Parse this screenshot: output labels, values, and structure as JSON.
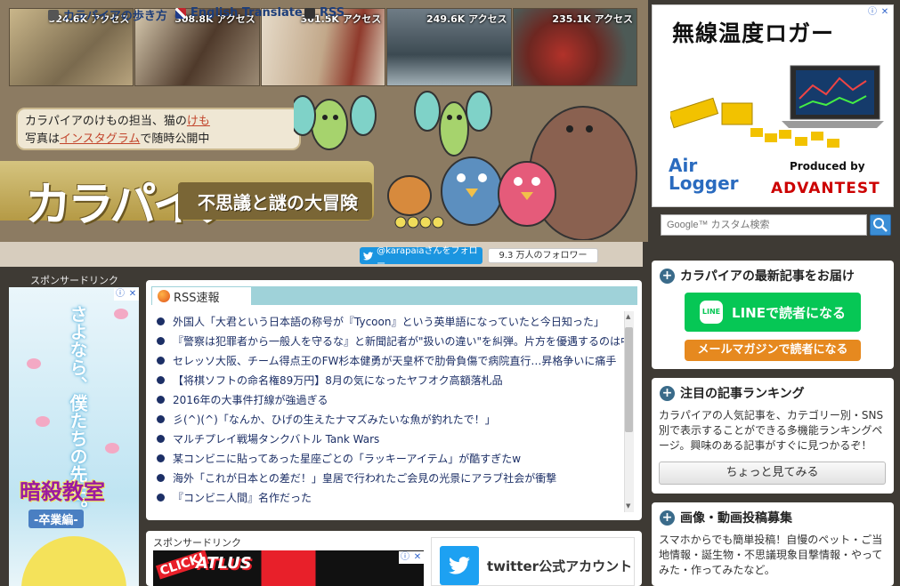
{
  "thumbnails": [
    {
      "views": "324.6K アクセス"
    },
    {
      "views": "308.8K アクセス"
    },
    {
      "views": "301.5K アクセス"
    },
    {
      "views": "249.6K アクセス"
    },
    {
      "views": "235.1K アクセス"
    }
  ],
  "cat_bubble": {
    "line1_prefix": "カラパイアのけもの担当、猫の",
    "line1_link": "けも",
    "line2_prefix": "写真は",
    "line2_link": "インスタグラム",
    "line2_suffix": "で随時公開中"
  },
  "logo": {
    "text": "カラパイア",
    "tagline": "不思議と謎の大冒険"
  },
  "nav": {
    "guide": "カラパイアの歩き方",
    "translate": "English Translate",
    "rss": "RSS",
    "twitter_follow": "@karapaiaさんをフォロー",
    "followers": "9.3 万人のフォロワー"
  },
  "ad_top": {
    "headline": "無線温度ロガー",
    "brand_left_line1": "Air",
    "brand_left_line2": "Logger",
    "produced_by": "Produced by",
    "brand_right": "ADVANTEST"
  },
  "search": {
    "placeholder": "Google™ カスタム検索"
  },
  "sponsor_left": {
    "title": "スポンサードリンク",
    "ad_vertical_text": "さよなら、僕たちの先生。",
    "ad_title": "暗殺教室",
    "ad_subtitle": "-卒業編-"
  },
  "rss": {
    "tab_label": "RSS速報",
    "items": [
      "外国人「大君という日本語の称号が『Tycoon』という英単語になっていたと今日知った」",
      "『警察は犯罪者から一般人を守るな』と新聞記者が\"扱いの違い\"を糾弾。片方を優遇するのは中立違反だ",
      "セレッソ大阪、チーム得点王のFW杉本健勇が天皇杯で肋骨負傷で病院直行…昇格争いに痛手",
      "【将棋ソフトの命名権89万円】8月の気になったヤフオク高額落札品",
      "2016年の大事件打線が強過ぎる",
      "彡(^)(^)「なんか、ひげの生えたナマズみたいな魚が釣れたで！」",
      "マルチプレイ戦場タンクバトル Tank Wars",
      "某コンビニに貼ってあった星座ごとの「ラッキーアイテム」が酷すぎたw",
      "海外「これが日本との差だ！」皇居で行われたご会見の光景にアラブ社会が衝撃",
      "『コンビニ人間』名作だった",
      "…"
    ]
  },
  "sponsor_mid": {
    "title": "スポンサードリンク",
    "ad_click": "CLICK!",
    "ad_brand": "ATLUS"
  },
  "twitter_card": {
    "label": "twitter公式アカウント"
  },
  "widgets": {
    "subscribe": {
      "title": "カラパイアの最新記事をお届け",
      "line_button": "LINEで読者になる",
      "line_icon": "LINE",
      "mail_button": "メールマガジンで読者になる"
    },
    "ranking": {
      "title": "注目の記事ランキング",
      "text": "カラパイアの人気記事を、カテゴリー別・SNS別で表示することができる多機能ランキングページ。興味のある記事がすぐに見つかるぞ！",
      "button": "ちょっと見てみる"
    },
    "submissions": {
      "title": "画像・動画投稿募集",
      "text": "スマホからでも簡単投稿！自慢のペット・ご当地情報・誕生物・不思議現象目撃情報・やってみた・作ってみたなど。"
    }
  }
}
